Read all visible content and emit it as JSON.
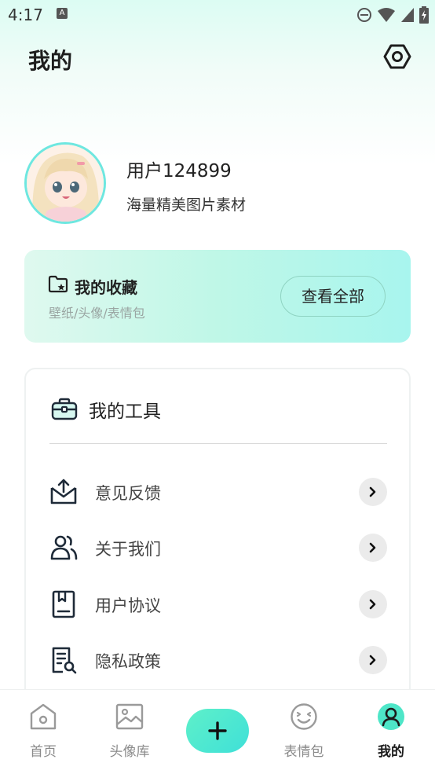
{
  "status_bar": {
    "time": "4:17",
    "sim_label": "A"
  },
  "page": {
    "title": "我的"
  },
  "profile": {
    "username": "用户124899",
    "subtitle": "海量精美图片素材"
  },
  "favorites": {
    "title": "我的收藏",
    "subtitle": "壁纸/头像/表情包",
    "button": "查看全部"
  },
  "tools": {
    "title": "我的工具",
    "items": [
      {
        "label": "意见反馈",
        "icon": "mail-upload-icon"
      },
      {
        "label": "关于我们",
        "icon": "users-icon"
      },
      {
        "label": "用户协议",
        "icon": "agreement-book-icon"
      },
      {
        "label": "隐私政策",
        "icon": "document-search-icon"
      }
    ]
  },
  "tabbar": {
    "items": [
      {
        "label": "首页",
        "icon": "home-icon"
      },
      {
        "label": "头像库",
        "icon": "image-icon"
      },
      {
        "label": "表情包",
        "icon": "smiley-icon"
      },
      {
        "label": "我的",
        "icon": "user-icon",
        "active": true
      }
    ],
    "plus_icon": "plus-icon"
  },
  "colors": {
    "accent": "#3ee3cf",
    "active_tab": "#4ee6c8"
  }
}
